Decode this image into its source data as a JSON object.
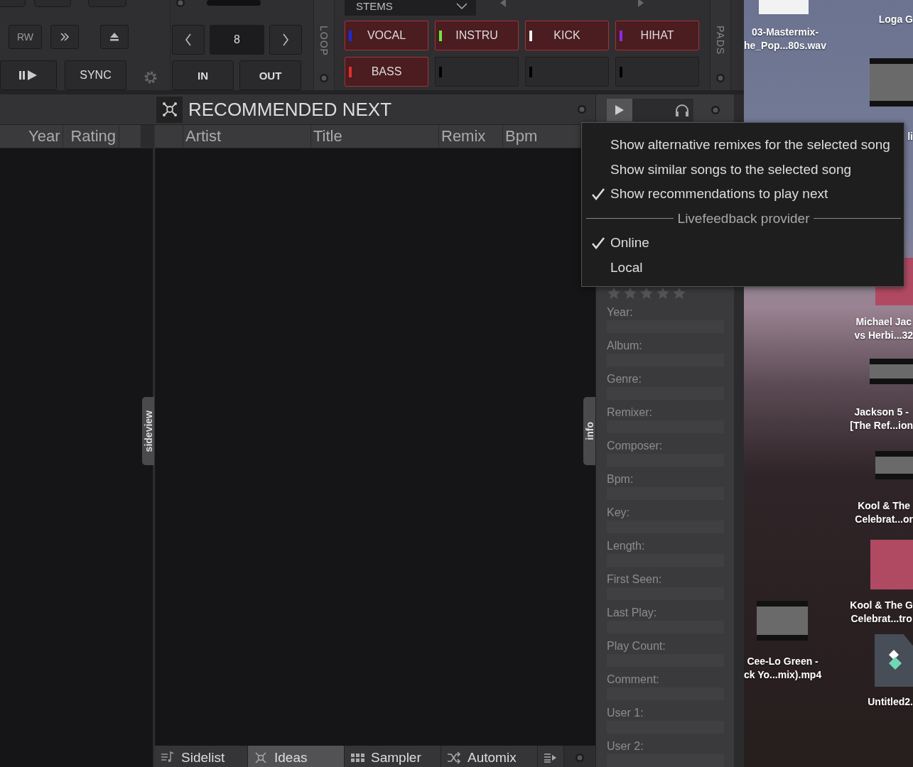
{
  "deck": {
    "transport": [
      {
        "kind": "text",
        "label": "RW"
      },
      {
        "kind": "skip"
      },
      {
        "kind": "eject"
      }
    ],
    "play_row": [
      {
        "kind": "play-pause"
      },
      {
        "kind": "text",
        "label": "SYNC"
      }
    ],
    "loop": {
      "size": "8",
      "buttons": [
        "IN",
        "OUT"
      ],
      "label": "LOOP"
    },
    "stems": {
      "label": "STEMS"
    },
    "pads": [
      {
        "label": "VOCAL",
        "color": "#1a2be0",
        "active": true
      },
      {
        "label": "INSTRU",
        "color": "#6ee83a",
        "active": true
      },
      {
        "label": "KICK",
        "color": "#f2f2f2",
        "active": true
      },
      {
        "label": "HIHAT",
        "color": "#8a2be8",
        "active": true
      },
      {
        "label": "BASS",
        "color": "#e0302a",
        "active": true
      },
      {
        "color": "#000000",
        "active": false
      },
      {
        "color": "#000000",
        "active": false
      },
      {
        "color": "#000000",
        "active": false
      }
    ],
    "pads_label": "PADS"
  },
  "browser": {
    "left_columns": [
      "Year",
      "Rating"
    ],
    "sideview_tab": "sideview",
    "panel_title": "RECOMMENDED NEXT",
    "columns": [
      "Artist",
      "Title",
      "Remix",
      "Bpm"
    ],
    "info_tab": "info"
  },
  "info_panel": {
    "stars": 0,
    "fields": [
      "Year:",
      "Album:",
      "Genre:",
      "Remixer:",
      "Composer:",
      "Bpm:",
      "Key:",
      "Length:",
      "First Seen:",
      "Last Play:",
      "Play Count:",
      "Comment:",
      "User 1:",
      "User 2:"
    ]
  },
  "bottom_tabs": [
    {
      "kind": "sidelist",
      "label": "Sidelist",
      "selected": false
    },
    {
      "kind": "ideas",
      "label": "Ideas",
      "selected": true
    },
    {
      "kind": "sampler",
      "label": "Sampler",
      "selected": false
    },
    {
      "kind": "automix",
      "label": "Automix",
      "selected": false
    }
  ],
  "menu": {
    "items": [
      {
        "kind": "option",
        "label": "Show alternative remixes for the selected song",
        "checked": false
      },
      {
        "kind": "option",
        "label": "Show similar songs to the selected song",
        "checked": false
      },
      {
        "kind": "option",
        "label": "Show recommendations to play next",
        "checked": true
      },
      {
        "kind": "section",
        "label": "Livefeedback provider"
      },
      {
        "kind": "option",
        "label": "Online",
        "checked": true
      },
      {
        "kind": "option",
        "label": "Local",
        "checked": false
      }
    ]
  },
  "desktop": {
    "items": [
      {
        "kind": "file-thumbnail"
      },
      {
        "kind": "label",
        "label": [
          "Loga G"
        ]
      },
      {
        "kind": "label",
        "label": [
          "03-Mastermix-",
          "he_Pop...80s.wav"
        ]
      },
      {
        "kind": "photo"
      },
      {
        "kind": "label",
        "label": [
          "li"
        ]
      },
      {
        "kind": "album"
      },
      {
        "kind": "label",
        "label": [
          "Michael Jac",
          "vs Herbi...32"
        ]
      },
      {
        "kind": "photo"
      },
      {
        "kind": "label",
        "label": [
          "Jackson 5 -",
          "[The Ref...ion"
        ]
      },
      {
        "kind": "photo"
      },
      {
        "kind": "label",
        "label": [
          "Kool & The",
          "Celebrat...or"
        ]
      },
      {
        "kind": "album"
      },
      {
        "kind": "label",
        "label": [
          "Kool & The G",
          "Celebrat...tro"
        ]
      },
      {
        "kind": "photo"
      },
      {
        "kind": "label",
        "label": [
          "Cee-Lo Green -",
          "ck Yo...mix).mp4"
        ]
      },
      {
        "kind": "document"
      },
      {
        "kind": "label",
        "label": [
          "Untitled2."
        ]
      }
    ]
  }
}
